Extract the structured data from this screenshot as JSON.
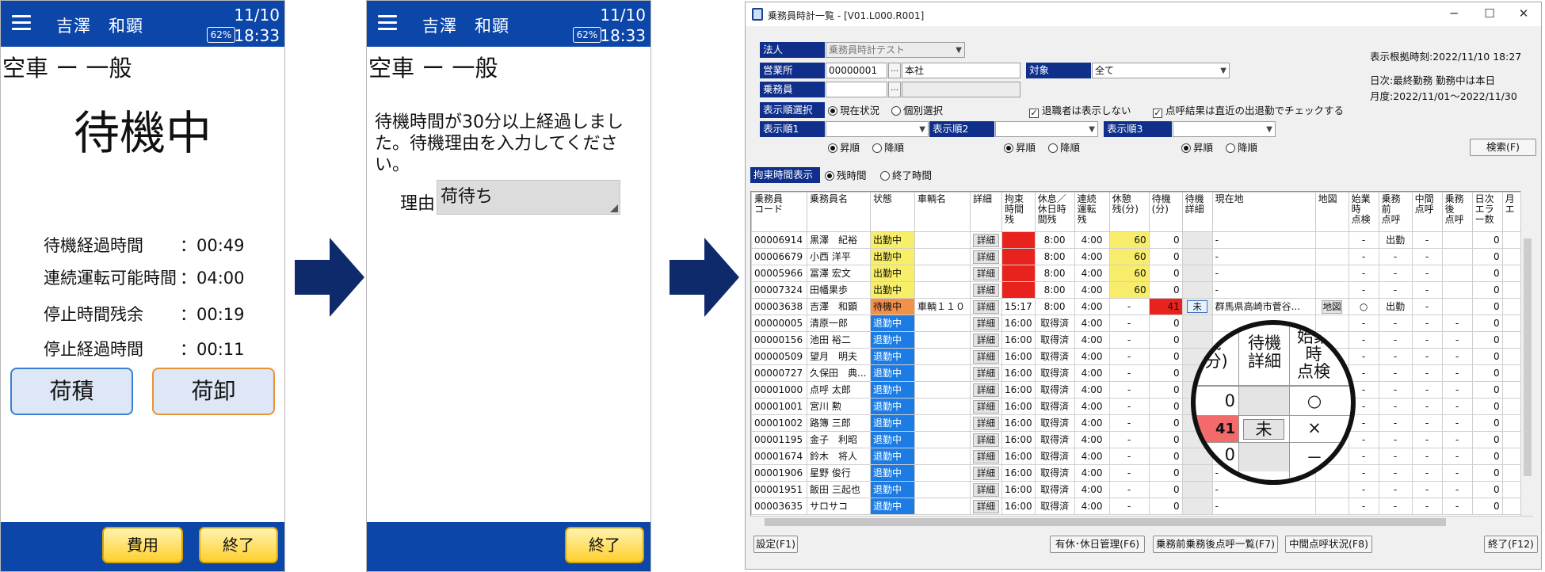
{
  "phone1": {
    "user_name": "吉澤　和顕",
    "date": "11/10",
    "time": "18:33",
    "battery": "62%",
    "status": "空車 ー 一般",
    "big_status": "待機中",
    "stats": [
      {
        "label": "待機経過時間",
        "value": "：00:49"
      },
      {
        "label": "連続運転可能時間",
        "value": "：04:00"
      },
      {
        "label": "停止時間残余",
        "value": "：00:19"
      },
      {
        "label": "停止経過時間",
        "value": "：00:11"
      }
    ],
    "load_button": "荷積",
    "unload_button": "荷卸",
    "cost_button": "費用",
    "end_button": "終了"
  },
  "phone2": {
    "user_name": "吉澤　和顕",
    "date": "11/10",
    "time": "18:33",
    "battery": "62%",
    "status": "空車 ー 一般",
    "message": "待機時間が30分以上経過しました。待機理由を入力してください。",
    "reason_label": "理由",
    "reason_value": "荷待ち",
    "end_button": "終了"
  },
  "window": {
    "title": "乗務員時計一覧 - [V01.L000.R001]",
    "corp_label": "法人",
    "corp_value": "乗務員時計テスト",
    "office_label": "営業所",
    "office_code": "00000001",
    "office_name": "本社",
    "target_label": "対象",
    "target_value": "全て",
    "crew_label": "乗務員",
    "order_label": "表示順選択",
    "order_opt_current": "現在状況",
    "order_opt_individual": "個別選択",
    "hide_retired": "退職者は表示しない",
    "roll_call_check": "点呼結果は直近の出退勤でチェックする",
    "order1_label": "表示順1",
    "order2_label": "表示順2",
    "order3_label": "表示順3",
    "asc": "昇順",
    "desc": "降順",
    "info_time": "表示根拠時刻:2022/11/10 18:27",
    "info_daily": "日次:最終勤務 勤務中は本日",
    "info_monthly": "月度:2022/11/01～2022/11/30",
    "search_button": "検索(F)",
    "restraint_label": "拘束時間表示",
    "restraint_remaining": "残時間",
    "restraint_end": "終了時間",
    "footer_settings": "設定(F1)",
    "footer_leave": "有休･休日管理(F6)",
    "footer_rollcall_list": "乗務前乗務後点呼一覧(F7)",
    "footer_mid_rollcall": "中間点呼状況(F8)",
    "footer_exit": "終了(F12)"
  },
  "table": {
    "headers": [
      "乗務員\nコード",
      "乗務員名",
      "状態",
      "車輌名",
      "詳細",
      "拘束\n時間\n残",
      "休息／\n休日時\n間残",
      "連続\n運転\n残",
      "休憩\n残(分)",
      "待機\n(分)",
      "待機\n詳細",
      "現在地",
      "地図",
      "始業\n時\n点検",
      "乗務\n前\n点呼",
      "中間\n点呼",
      "乗務\n後\n点呼",
      "日次\nエラ\nー数",
      "月\nエ"
    ],
    "rows": [
      {
        "code": "00006914",
        "name": "黒澤　紀裕",
        "status": "出勤中",
        "car": "",
        "detail": "詳細",
        "restraint": "",
        "rest": "8:00",
        "drive": "4:00",
        "break": "60",
        "wait": "0",
        "wait_detail": "",
        "loc": "-",
        "map": "",
        "start_check": "-",
        "pre_call": "出勤",
        "mid_call": "-",
        "post_call": "",
        "errors": "0"
      },
      {
        "code": "00006679",
        "name": "小西 洋平",
        "status": "出勤中",
        "car": "",
        "detail": "詳細",
        "restraint": "",
        "rest": "8:00",
        "drive": "4:00",
        "break": "60",
        "wait": "0",
        "wait_detail": "",
        "loc": "-",
        "map": "",
        "start_check": "-",
        "pre_call": "-",
        "mid_call": "-",
        "post_call": "",
        "errors": "0"
      },
      {
        "code": "00005966",
        "name": "冨澤 宏文",
        "status": "出勤中",
        "car": "",
        "detail": "詳細",
        "restraint": "",
        "rest": "8:00",
        "drive": "4:00",
        "break": "60",
        "wait": "0",
        "wait_detail": "",
        "loc": "-",
        "map": "",
        "start_check": "-",
        "pre_call": "-",
        "mid_call": "-",
        "post_call": "",
        "errors": "0"
      },
      {
        "code": "00007324",
        "name": "田幡果歩",
        "status": "出勤中",
        "car": "",
        "detail": "詳細",
        "restraint": "",
        "rest": "8:00",
        "drive": "4:00",
        "break": "60",
        "wait": "0",
        "wait_detail": "",
        "loc": "-",
        "map": "",
        "start_check": "-",
        "pre_call": "-",
        "mid_call": "-",
        "post_call": "",
        "errors": "0"
      },
      {
        "code": "00003638",
        "name": "吉澤　和顕",
        "status": "待機中",
        "car": "車輌１１０",
        "detail": "詳細",
        "restraint": "15:17",
        "rest": "8:00",
        "drive": "4:00",
        "break": "-",
        "wait": "41",
        "wait_detail": "未",
        "loc": "群馬県高崎市菅谷...",
        "map": "地図",
        "start_check": "○",
        "pre_call": "出勤",
        "mid_call": "-",
        "post_call": "",
        "errors": "0"
      },
      {
        "code": "00000005",
        "name": "清原一郎",
        "status": "退勤中",
        "car": "",
        "detail": "詳細",
        "restraint": "16:00",
        "rest": "取得済",
        "drive": "4:00",
        "break": "-",
        "wait": "0",
        "wait_detail": "",
        "loc": "",
        "map": "",
        "start_check": "-",
        "pre_call": "-",
        "mid_call": "-",
        "post_call": "-",
        "errors": "0"
      },
      {
        "code": "00000156",
        "name": "池田 裕二",
        "status": "退勤中",
        "car": "",
        "detail": "詳細",
        "restraint": "16:00",
        "rest": "取得済",
        "drive": "4:00",
        "break": "-",
        "wait": "0",
        "wait_detail": "",
        "loc": "",
        "map": "",
        "start_check": "-",
        "pre_call": "-",
        "mid_call": "-",
        "post_call": "-",
        "errors": "0"
      },
      {
        "code": "00000509",
        "name": "望月　明夫",
        "status": "退勤中",
        "car": "",
        "detail": "詳細",
        "restraint": "16:00",
        "rest": "取得済",
        "drive": "4:00",
        "break": "-",
        "wait": "0",
        "wait_detail": "",
        "loc": "",
        "map": "",
        "start_check": "-",
        "pre_call": "-",
        "mid_call": "-",
        "post_call": "-",
        "errors": "0"
      },
      {
        "code": "00000727",
        "name": "久保田　典...",
        "status": "退勤中",
        "car": "",
        "detail": "詳細",
        "restraint": "16:00",
        "rest": "取得済",
        "drive": "4:00",
        "break": "-",
        "wait": "0",
        "wait_detail": "",
        "loc": "",
        "map": "",
        "start_check": "-",
        "pre_call": "-",
        "mid_call": "-",
        "post_call": "-",
        "errors": "0"
      },
      {
        "code": "00001000",
        "name": "点呼 太郎",
        "status": "退勤中",
        "car": "",
        "detail": "詳細",
        "restraint": "16:00",
        "rest": "取得済",
        "drive": "4:00",
        "break": "-",
        "wait": "0",
        "wait_detail": "",
        "loc": "",
        "map": "",
        "start_check": "-",
        "pre_call": "-",
        "mid_call": "-",
        "post_call": "-",
        "errors": "0"
      },
      {
        "code": "00001001",
        "name": "宮川 勲",
        "status": "退勤中",
        "car": "",
        "detail": "詳細",
        "restraint": "16:00",
        "rest": "取得済",
        "drive": "4:00",
        "break": "-",
        "wait": "0",
        "wait_detail": "",
        "loc": "",
        "map": "",
        "start_check": "-",
        "pre_call": "-",
        "mid_call": "-",
        "post_call": "-",
        "errors": "0"
      },
      {
        "code": "00001002",
        "name": "路簿 三郎",
        "status": "退勤中",
        "car": "",
        "detail": "詳細",
        "restraint": "16:00",
        "rest": "取得済",
        "drive": "4:00",
        "break": "-",
        "wait": "0",
        "wait_detail": "",
        "loc": "",
        "map": "",
        "start_check": "-",
        "pre_call": "-",
        "mid_call": "-",
        "post_call": "-",
        "errors": "0"
      },
      {
        "code": "00001195",
        "name": "金子　利昭",
        "status": "退勤中",
        "car": "",
        "detail": "詳細",
        "restraint": "16:00",
        "rest": "取得済",
        "drive": "4:00",
        "break": "-",
        "wait": "0",
        "wait_detail": "",
        "loc": "",
        "map": "",
        "start_check": "-",
        "pre_call": "-",
        "mid_call": "-",
        "post_call": "-",
        "errors": "0"
      },
      {
        "code": "00001674",
        "name": "鈴木　将人",
        "status": "退勤中",
        "car": "",
        "detail": "詳細",
        "restraint": "16:00",
        "rest": "取得済",
        "drive": "4:00",
        "break": "-",
        "wait": "0",
        "wait_detail": "",
        "loc": "",
        "map": "",
        "start_check": "-",
        "pre_call": "-",
        "mid_call": "-",
        "post_call": "-",
        "errors": "0"
      },
      {
        "code": "00001906",
        "name": "星野 俊行",
        "status": "退勤中",
        "car": "",
        "detail": "詳細",
        "restraint": "16:00",
        "rest": "取得済",
        "drive": "4:00",
        "break": "-",
        "wait": "0",
        "wait_detail": "",
        "loc": "-",
        "map": "",
        "start_check": "-",
        "pre_call": "-",
        "mid_call": "-",
        "post_call": "-",
        "errors": "0"
      },
      {
        "code": "00001951",
        "name": "飯田 三起也",
        "status": "退勤中",
        "car": "",
        "detail": "詳細",
        "restraint": "16:00",
        "rest": "取得済",
        "drive": "4:00",
        "break": "-",
        "wait": "0",
        "wait_detail": "",
        "loc": "-",
        "map": "",
        "start_check": "-",
        "pre_call": "-",
        "mid_call": "-",
        "post_call": "-",
        "errors": "0"
      },
      {
        "code": "00003635",
        "name": "サロサコ",
        "status": "退勤中",
        "car": "",
        "detail": "詳細",
        "restraint": "16:00",
        "rest": "取得済",
        "drive": "4:00",
        "break": "-",
        "wait": "0",
        "wait_detail": "",
        "loc": "-",
        "map": "",
        "start_check": "-",
        "pre_call": "-",
        "mid_call": "-",
        "post_call": "-",
        "errors": "0"
      }
    ]
  },
  "magnifier": {
    "h1": "機\n(分)",
    "h2": "待機\n詳細",
    "h3": "始業\n時\n点検",
    "r1": [
      "0",
      "",
      "○"
    ],
    "r2": [
      "41",
      "未",
      "×"
    ],
    "r3": [
      "0",
      "",
      "－"
    ]
  },
  "colors": {
    "header_blue": "#0b46a8",
    "label_navy": "#0f2f8a",
    "status_working": "#f8ef68",
    "status_waiting": "#f2914a",
    "status_off": "#1c7ce4",
    "alert_red": "#e8231e",
    "arrow_navy": "#0f2a6b"
  },
  "icons": [
    "menu-icon",
    "battery-icon",
    "arrow-right-icon",
    "app-icon",
    "minimize-icon",
    "maximize-icon",
    "close-icon",
    "dropdown-icon"
  ]
}
